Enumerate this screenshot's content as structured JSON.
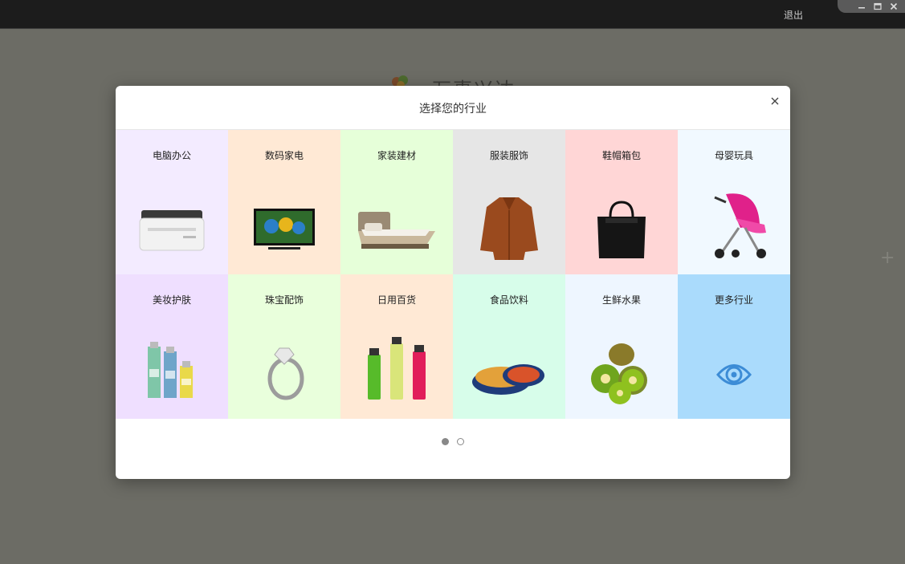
{
  "window": {
    "exit_label": "退出"
  },
  "background": {
    "app_name": "万事兴达"
  },
  "dialog": {
    "title": "选择您的行业",
    "industries": [
      {
        "label": "电脑办公",
        "bg": "#f3ebff",
        "icon": "printer-icon"
      },
      {
        "label": "数码家电",
        "bg": "#ffe9d5",
        "icon": "tv-icon"
      },
      {
        "label": "家装建材",
        "bg": "#e6ffd9",
        "icon": "bed-icon"
      },
      {
        "label": "服装服饰",
        "bg": "#e6e6e6",
        "icon": "coat-icon"
      },
      {
        "label": "鞋帽箱包",
        "bg": "#ffd6d6",
        "icon": "handbag-icon"
      },
      {
        "label": "母婴玩具",
        "bg": "#f1f9ff",
        "icon": "stroller-icon"
      },
      {
        "label": "美妆护肤",
        "bg": "#efdfff",
        "icon": "cosmetics-icon"
      },
      {
        "label": "珠宝配饰",
        "bg": "#e9ffdc",
        "icon": "ring-icon"
      },
      {
        "label": "日用百货",
        "bg": "#ffe9d5",
        "icon": "bottles-icon"
      },
      {
        "label": "食品饮料",
        "bg": "#d7fdea",
        "icon": "cookie-tin-icon"
      },
      {
        "label": "生鲜水果",
        "bg": "#eef6ff",
        "icon": "kiwi-icon"
      },
      {
        "label": "更多行业",
        "bg": "#aadbfc",
        "icon": "eye-icon"
      }
    ]
  },
  "pager": {
    "total": 2,
    "current": 1
  }
}
